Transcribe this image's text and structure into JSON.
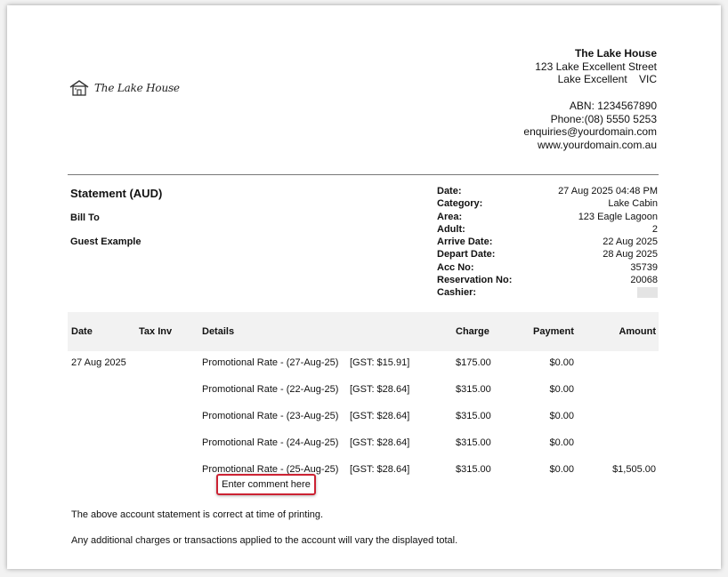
{
  "logo": {
    "text": "The Lake House",
    "icon": "house-icon"
  },
  "company": {
    "name": "The Lake House",
    "street": "123 Lake Excellent Street",
    "city_state": "Lake Excellent    VIC",
    "abn": "ABN: 1234567890",
    "phone": "Phone:(08) 5550 5253",
    "email": "enquiries@yourdomain.com",
    "website": "www.yourdomain.com.au"
  },
  "statement": {
    "title": "Statement (AUD)",
    "bill_to_label": "Bill To",
    "guest_name": "Guest Example"
  },
  "meta": [
    {
      "label": "Date:",
      "value": "27 Aug 2025 04:48 PM"
    },
    {
      "label": "Category:",
      "value": "Lake Cabin"
    },
    {
      "label": "Area:",
      "value": "123 Eagle Lagoon"
    },
    {
      "label": "Adult:",
      "value": "2"
    },
    {
      "label": "Arrive Date:",
      "value": "22 Aug 2025"
    },
    {
      "label": "Depart Date:",
      "value": "28 Aug 2025"
    },
    {
      "label": "Acc No:",
      "value": "35739"
    },
    {
      "label": "Reservation No:",
      "value": "20068"
    },
    {
      "label": "Cashier:",
      "value": ""
    }
  ],
  "table": {
    "headers": {
      "date": "Date",
      "taxinv": "Tax Inv",
      "details": "Details",
      "charge": "Charge",
      "payment": "Payment",
      "amount": "Amount"
    },
    "rows": [
      {
        "date": "27 Aug 2025",
        "details": "Promotional Rate  - (27-Aug-25)",
        "gst": "[GST: $15.91]",
        "charge": "$175.00",
        "payment": "$0.00",
        "amount": ""
      },
      {
        "date": "",
        "details": "Promotional Rate  - (22-Aug-25)",
        "gst": "[GST: $28.64]",
        "charge": "$315.00",
        "payment": "$0.00",
        "amount": ""
      },
      {
        "date": "",
        "details": "Promotional Rate  - (23-Aug-25)",
        "gst": "[GST: $28.64]",
        "charge": "$315.00",
        "payment": "$0.00",
        "amount": ""
      },
      {
        "date": "",
        "details": "Promotional Rate  - (24-Aug-25)",
        "gst": "[GST: $28.64]",
        "charge": "$315.00",
        "payment": "$0.00",
        "amount": ""
      },
      {
        "date": "",
        "details": "Promotional Rate  - (25-Aug-25)",
        "gst": "[GST: $28.64]",
        "charge": "$315.00",
        "payment": "$0.00",
        "amount": "$1,505.00"
      }
    ]
  },
  "comment_placeholder": "Enter comment here",
  "notes": [
    "The above account statement is correct at time of printing.",
    "Any additional charges or transactions applied to the account will vary the displayed total."
  ]
}
